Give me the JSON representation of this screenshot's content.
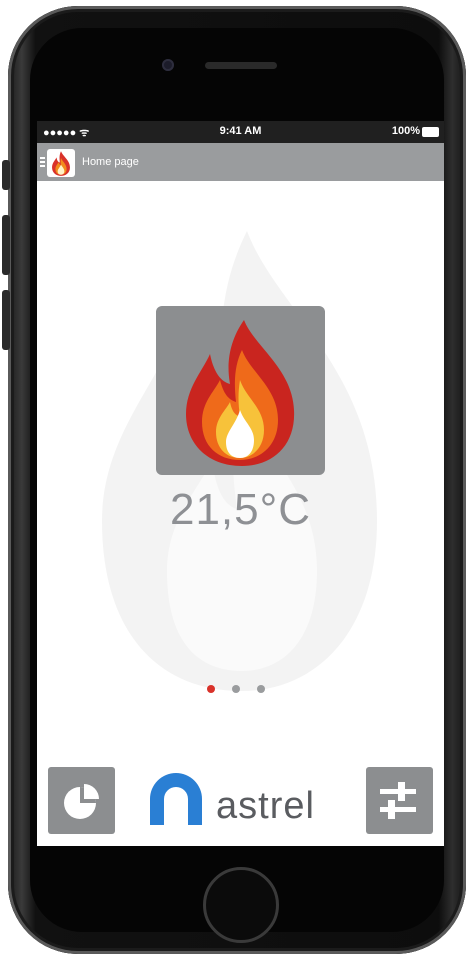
{
  "status_bar": {
    "signal": "●●●●● ᯤ",
    "time": "9:41 AM",
    "battery": "100%"
  },
  "header": {
    "title": "Home page",
    "menu_icon": "hamburger-icon",
    "logo_icon": "flame-icon"
  },
  "main": {
    "temperature": "21,5°C",
    "status_icon": "flame-icon",
    "pager": {
      "count": 3,
      "active": 0
    }
  },
  "bottom_bar": {
    "left_button_icon": "pie-chart-icon",
    "brand_name": "astrel",
    "right_button_icon": "sliders-icon"
  },
  "colors": {
    "accent": "#d9322a",
    "gray": "#8c8e90",
    "nav": "#9a9c9e",
    "brand_blue": "#2a7fd4"
  }
}
